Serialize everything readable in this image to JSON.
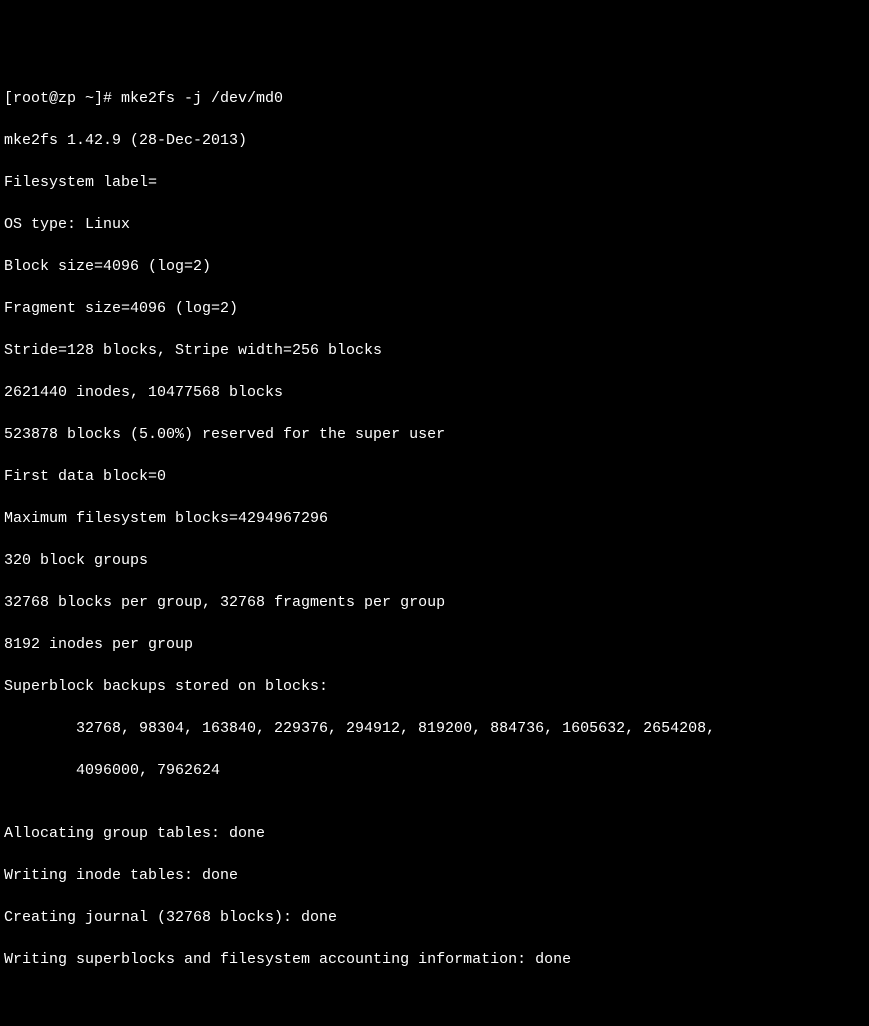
{
  "terminal": {
    "prompt": "[root@zp ~]# ",
    "command": "mke2fs -j /dev/md0",
    "lines": [
      "mke2fs 1.42.9 (28-Dec-2013)",
      "Filesystem label=",
      "OS type: Linux",
      "Block size=4096 (log=2)",
      "Fragment size=4096 (log=2)",
      "Stride=128 blocks, Stripe width=256 blocks",
      "2621440 inodes, 10477568 blocks",
      "523878 blocks (5.00%) reserved for the super user",
      "First data block=0",
      "Maximum filesystem blocks=4294967296",
      "320 block groups",
      "32768 blocks per group, 32768 fragments per group",
      "8192 inodes per group",
      "Superblock backups stored on blocks:"
    ],
    "backup_line1": "32768, 98304, 163840, 229376, 294912, 819200, 884736, 1605632, 2654208,",
    "backup_line2": "4096000, 7962624",
    "blank": "",
    "status_lines": [
      "Allocating group tables: done",
      "Writing inode tables: done",
      "Creating journal (32768 blocks): done",
      "Writing superblocks and filesystem accounting information: done"
    ]
  }
}
